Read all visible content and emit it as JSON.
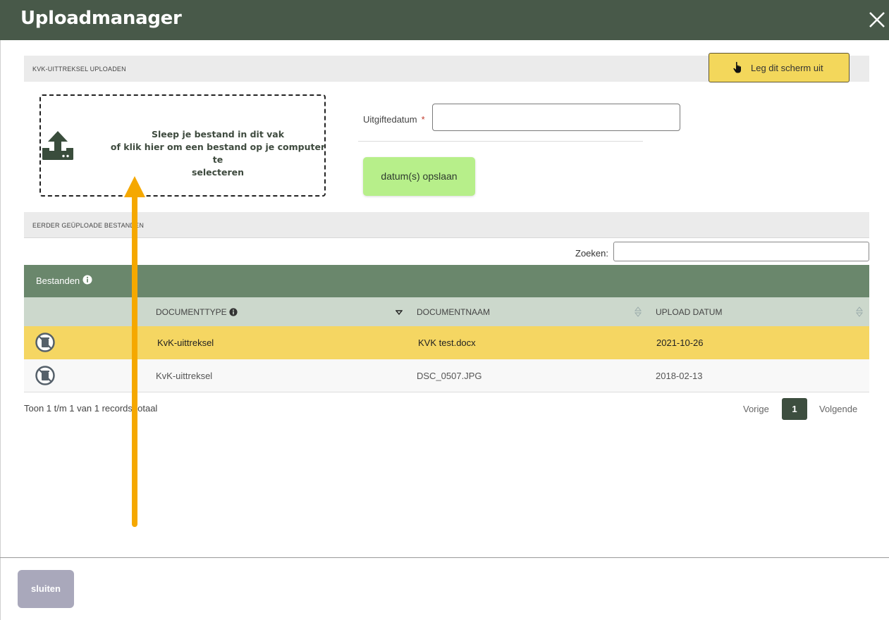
{
  "header": {
    "title": "Uploadmanager"
  },
  "upload_section": {
    "title": "KVK-uittreksel uploaden",
    "explain_button": "Leg dit scherm uit",
    "dropzone_text": "Sleep je bestand in dit vak\nof klik hier om een bestand op je computer te\nselecteren",
    "date_label": "Uitgiftedatum",
    "required_mark": "*",
    "date_value": "",
    "save_button": "datum(s) opslaan"
  },
  "previous_section": {
    "title": "Eerder geüploade bestanden",
    "search_label": "Zoeken:",
    "search_value": ""
  },
  "table": {
    "title": "Bestanden",
    "columns": [
      "DOCUMENTTYPE",
      "DOCUMENTNAAM",
      "UPLOAD DATUM"
    ],
    "rows": [
      {
        "type": "KvK-uittreksel",
        "name": "KVK test.docx",
        "date": "2021-10-26",
        "highlighted": true
      },
      {
        "type": "KvK-uittreksel",
        "name": "DSC_0507.JPG",
        "date": "2018-02-13",
        "highlighted": false
      }
    ]
  },
  "pagination": {
    "info": "Toon 1 t/m 1 van 1 records totaal",
    "prev": "Vorige",
    "current": "1",
    "next": "Volgende"
  },
  "footer": {
    "close_button": "sluiten"
  },
  "colors": {
    "header_bg": "#485949",
    "table_head_bg": "#6a876c",
    "highlight_row": "#f5d662",
    "save_button": "#b7ef8a",
    "annotation_arrow": "#f5a800"
  },
  "icons": [
    "close-icon",
    "hand-pointer-icon",
    "upload-icon",
    "info-icon",
    "sort-icon",
    "delete-icon"
  ]
}
